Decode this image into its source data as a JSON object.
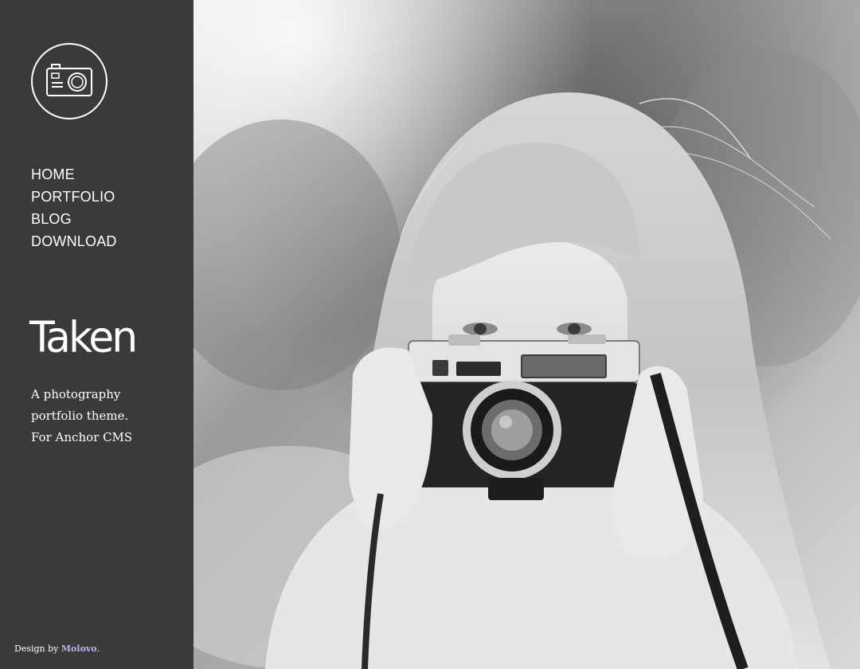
{
  "nav": {
    "items": [
      {
        "label": "HOME"
      },
      {
        "label": "PORTFOLIO"
      },
      {
        "label": "BLOG"
      },
      {
        "label": "DOWNLOAD"
      }
    ]
  },
  "site": {
    "title": "Taken",
    "tagline": [
      "A photography",
      "portfolio theme.",
      "For Anchor CMS"
    ]
  },
  "footer": {
    "credit_prefix": "Design by ",
    "credit_link": "Molovo",
    "credit_suffix": "."
  },
  "colors": {
    "sidebar": "#3a3a3a",
    "text": "#ffffff",
    "credit_link": "#b9b3ea"
  },
  "icons": {
    "logo": "camera-icon"
  }
}
